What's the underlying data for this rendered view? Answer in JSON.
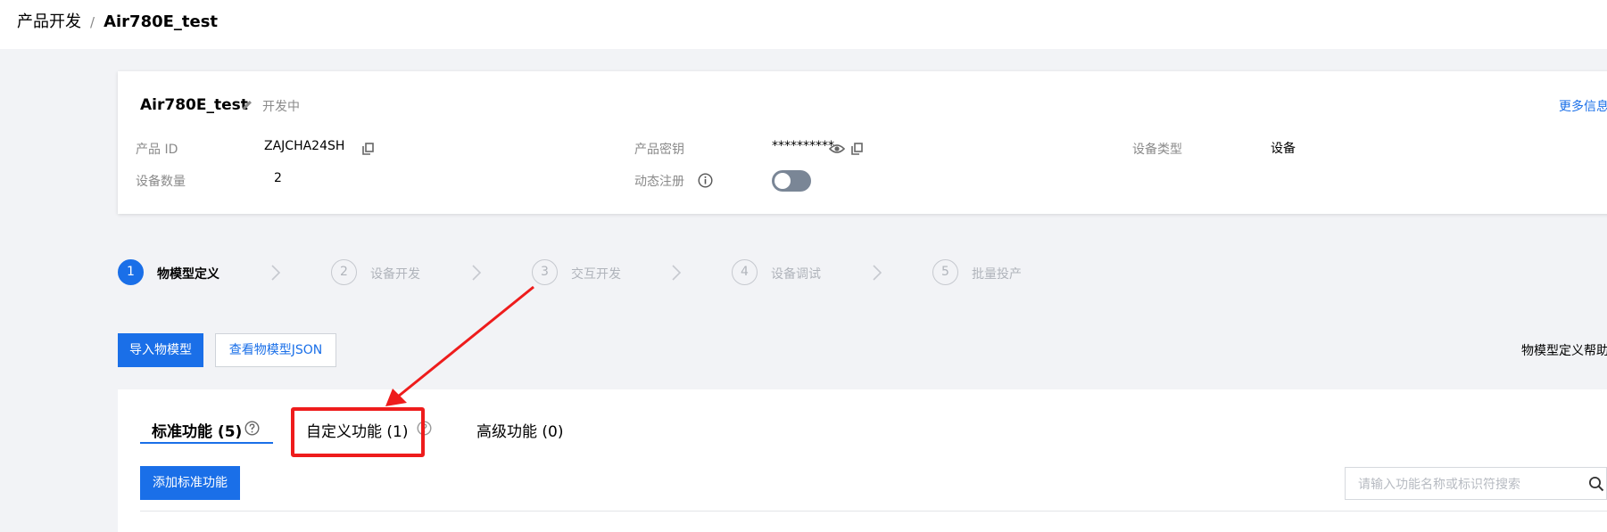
{
  "breadcrumb": {
    "parent": "产品开发",
    "separator": "/",
    "current": "Air780E_test"
  },
  "product": {
    "name": "Air780E_test",
    "status": "开发中",
    "more_link": "更多信息",
    "fields": {
      "product_id_label": "产品 ID",
      "product_id_value": "ZAJCHA24SH",
      "secret_label": "产品密钥",
      "secret_value": "**********",
      "device_type_label": "设备类型",
      "device_type_value": "设备",
      "device_count_label": "设备数量",
      "device_count_value": "2",
      "dynamic_reg_label": "动态注册",
      "dynamic_reg_enabled": false
    }
  },
  "steps": [
    {
      "num": "1",
      "label": "物模型定义",
      "active": true
    },
    {
      "num": "2",
      "label": "设备开发",
      "active": false
    },
    {
      "num": "3",
      "label": "交互开发",
      "active": false
    },
    {
      "num": "4",
      "label": "设备调试",
      "active": false
    },
    {
      "num": "5",
      "label": "批量投产",
      "active": false
    }
  ],
  "actions": {
    "import_label": "导入物模型",
    "view_json_label": "查看物模型JSON",
    "help_link": "物模型定义帮助"
  },
  "tabs": [
    {
      "label": "标准功能 (5)",
      "active": true
    },
    {
      "label": "自定义功能 (1)",
      "active": false
    },
    {
      "label": "高级功能 (0)",
      "active": false
    }
  ],
  "toolbar": {
    "add_standard_label": "添加标准功能",
    "search_placeholder": "请输入功能名称或标识符搜索"
  },
  "colors": {
    "primary": "#1a6fe8",
    "annotation": "#ee1c1c",
    "page_bg": "#f2f3f6"
  },
  "icons": [
    "pencil-icon",
    "copy-icon",
    "eye-icon",
    "info-icon",
    "chevron-right-icon",
    "help-icon",
    "search-icon"
  ]
}
